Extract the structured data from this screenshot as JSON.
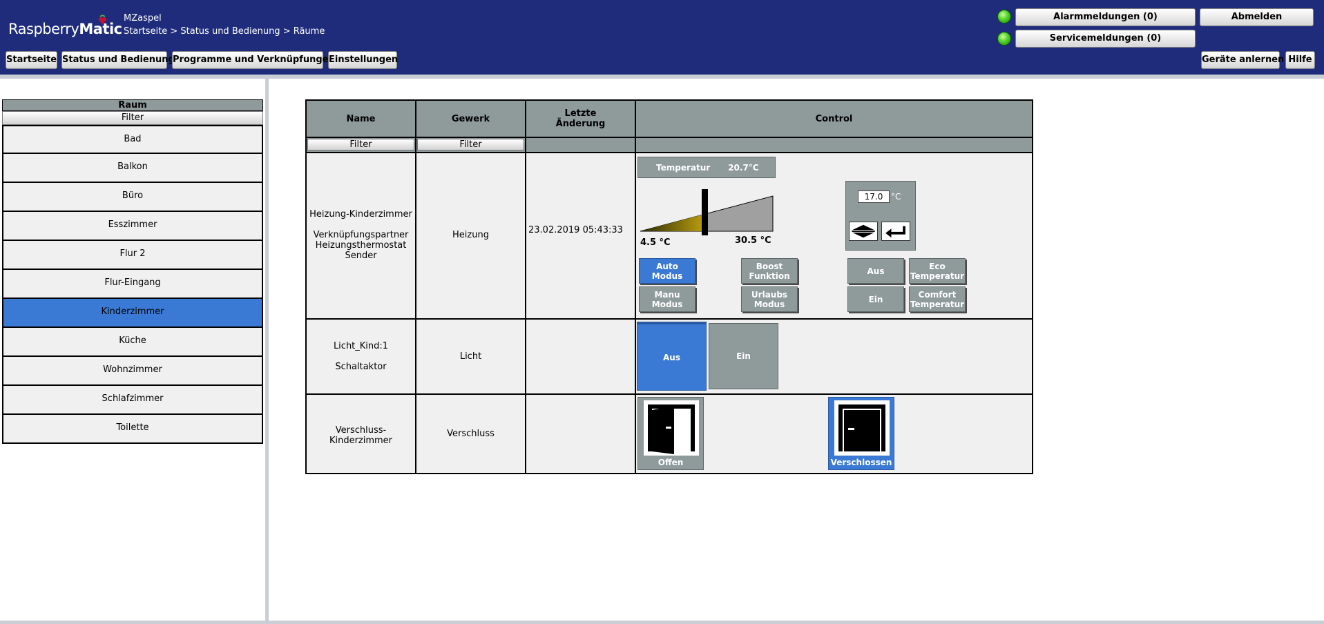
{
  "header": {
    "logo_light": "Raspberry",
    "logo_bold": "Matic",
    "user": "MZaspel",
    "breadcrumb": "Startseite > Status und Bedienung > Räume",
    "nav": [
      "Startseite",
      "Status und Bedienung",
      "Programme und Verknüpfungen",
      "Einstellungen"
    ],
    "alarm_label": "Alarmmeldungen (0)",
    "service_label": "Servicemeldungen (0)",
    "logout_label": "Abmelden",
    "teach_label": "Geräte anlernen",
    "help_label": "Hilfe",
    "led_color": "#52d12a",
    "bar_color": "#1f2c7c"
  },
  "rooms": {
    "header": "Raum",
    "filter": "Filter",
    "items": [
      "Bad",
      "Balkon",
      "Büro",
      "Esszimmer",
      "Flur 2",
      "Flur-Eingang",
      "Kinderzimmer",
      "Küche",
      "Wohnzimmer",
      "Schlafzimmer",
      "Toilette"
    ],
    "selected": "Kinderzimmer",
    "selected_color": "#3a7ad4"
  },
  "table": {
    "columns": [
      "Name",
      "Gewerk",
      "Letzte\nÄnderung",
      "Control"
    ],
    "filter_label": "Filter",
    "rows": [
      {
        "name_lines": [
          "Heizung-Kinderzimmer",
          "",
          "Verknüpfungspartner",
          "Heizungsthermostat",
          "Sender"
        ],
        "gewerk": "Heizung",
        "changed": "23.02.2019 05:43:33",
        "control": {
          "temp_label": "Temperatur",
          "temp_value": "20.7°C",
          "min_label": "4.5 °C",
          "max_label": "30.5 °C",
          "setpoint_value": "17.0",
          "setpoint_unit": "°C",
          "mode_buttons": [
            "Auto Modus",
            "Manu Modus",
            "Boost Funktion",
            "Urlaubs Modus"
          ],
          "active_mode": "Auto Modus",
          "switch_buttons": [
            "Aus",
            "Ein",
            "Eco Temperatur",
            "Comfort Temperatur"
          ]
        }
      },
      {
        "name_lines": [
          "Licht_Kind:1",
          "",
          "Schaltaktor"
        ],
        "gewerk": "Licht",
        "changed": "",
        "control": {
          "off_label": "Aus",
          "on_label": "Ein",
          "state": "Aus"
        }
      },
      {
        "name_lines": [
          "Verschluss-Kinderzimmer"
        ],
        "gewerk": "Verschluss",
        "changed": "",
        "control": {
          "open_label": "Offen",
          "closed_label": "Verschlossen",
          "state": "Verschlossen"
        }
      }
    ]
  }
}
